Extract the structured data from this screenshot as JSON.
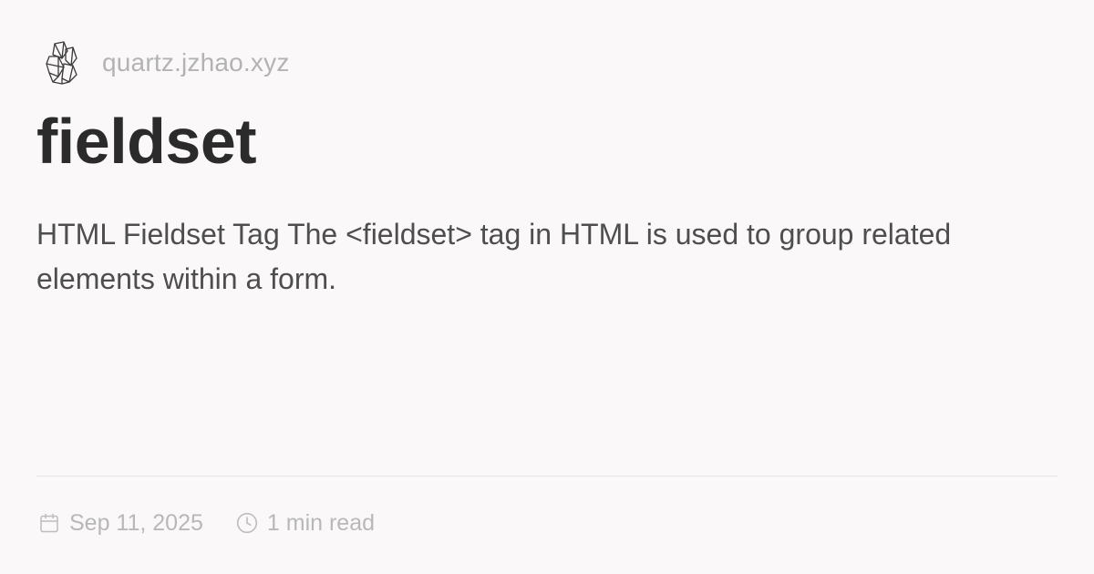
{
  "header": {
    "logo_icon": "crystal-logo-icon",
    "site_name": "quartz.jzhao.xyz"
  },
  "page": {
    "title": "fieldset",
    "description": "HTML Fieldset Tag The <fieldset> tag in HTML is used to group related elements within a form."
  },
  "meta": {
    "date_icon": "calendar-icon",
    "date": "Sep 11, 2025",
    "reading_icon": "clock-icon",
    "reading_time": "1 min read"
  },
  "colors": {
    "background": "#faf8f8",
    "title": "#2b2b2b",
    "description": "#4e4e4e",
    "muted": "#b3b3b3",
    "divider": "#e6e4e4"
  }
}
